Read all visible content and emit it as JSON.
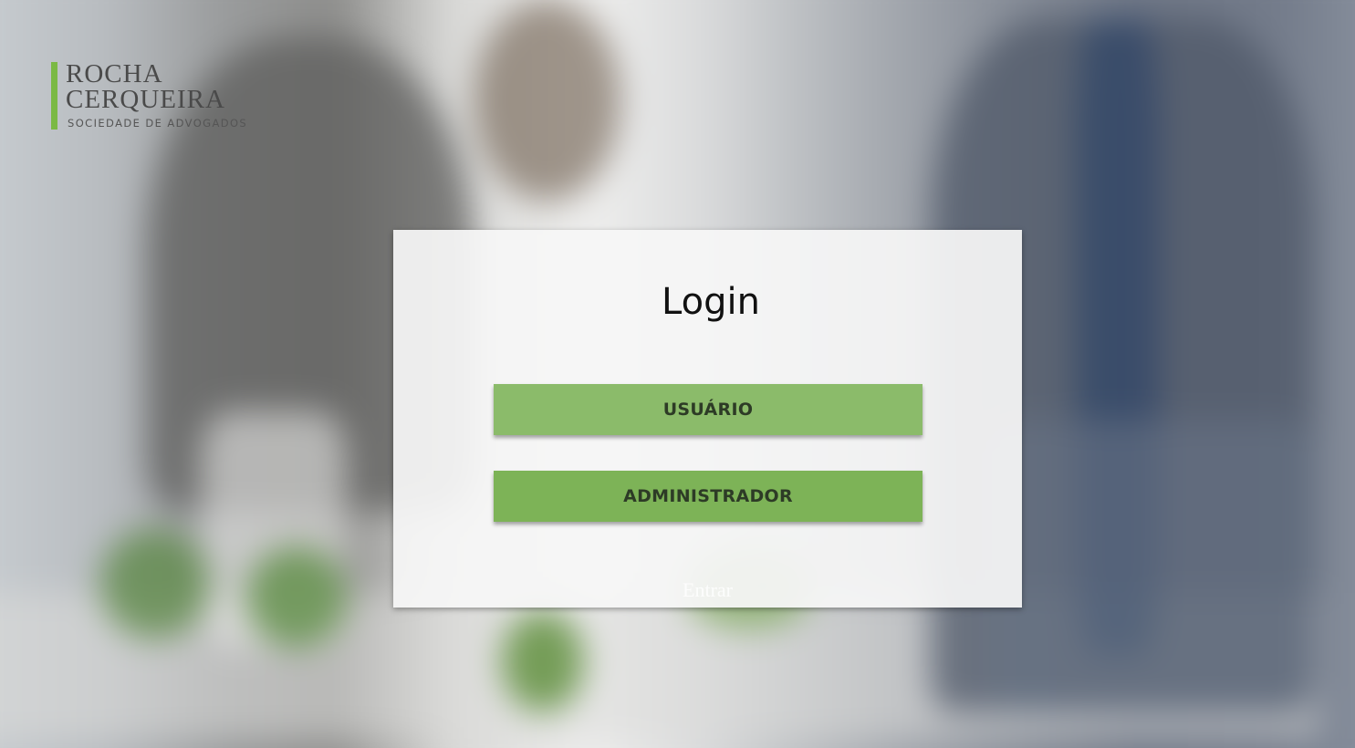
{
  "logo": {
    "line1": "ROCHA",
    "line2": "CERQUEIRA",
    "line3": "SOCIEDADE DE ADVOGADOS",
    "accent_color": "#7bb944"
  },
  "login": {
    "title": "Login",
    "user_button": "USUÁRIO",
    "admin_button": "ADMINISTRADOR",
    "enter_label": "Entrar",
    "button_color": "#7db357"
  }
}
